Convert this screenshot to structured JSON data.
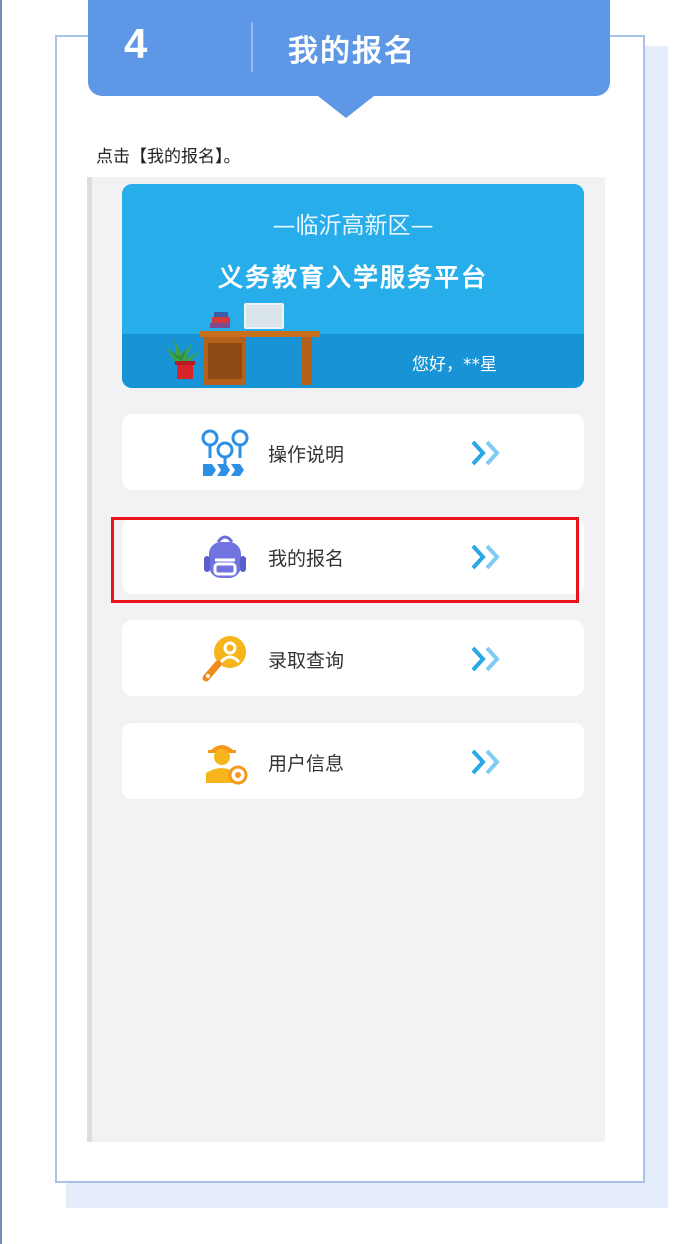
{
  "step": {
    "number": "4",
    "title": "我的报名"
  },
  "instruction": "点击【我的报名】。",
  "banner": {
    "subtitle": "—临沂高新区—",
    "title": "义务教育入学服务平台",
    "greeting": "您好，**星"
  },
  "menu": [
    {
      "label": "操作说明",
      "icon": "flowchart-icon",
      "highlighted": false
    },
    {
      "label": "我的报名",
      "icon": "backpack-icon",
      "highlighted": true
    },
    {
      "label": "录取查询",
      "icon": "search-person-icon",
      "highlighted": false
    },
    {
      "label": "用户信息",
      "icon": "user-icon",
      "highlighted": false
    }
  ],
  "colors": {
    "header": "#5d97e5",
    "banner": "#27ade9",
    "chevron": "#2aa7e6",
    "highlight": "#e8141b"
  }
}
